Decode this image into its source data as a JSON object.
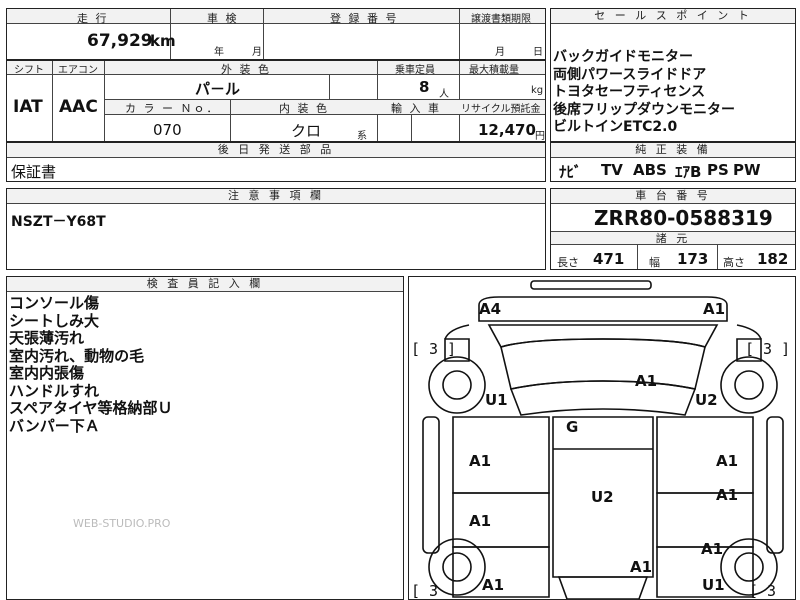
{
  "summary": {
    "mileage_label": "走 行",
    "mileage_value": "67,929",
    "mileage_unit": "km",
    "inspection_label": "車 検",
    "inspection_year": "年",
    "inspection_month": "月",
    "registration_label": "登 録 番 号",
    "transfer_deadline_label": "譲渡書類期限",
    "transfer_month": "月",
    "transfer_day": "日"
  },
  "specs": {
    "shift_label": "シフト",
    "shift_value": "IAT",
    "aircon_label": "エアコン",
    "aircon_value": "AAC",
    "exterior_color_label": "外 装 色",
    "exterior_color_value": "パ－ル",
    "capacity_label": "乗車定員",
    "capacity_value": "8",
    "capacity_unit": "人",
    "max_load_label": "最大積載量",
    "max_load_unit": "kg",
    "color_no_label": "カ ラ ー Ｎｏ．",
    "color_no_value": "070",
    "interior_color_label": "内 装 色",
    "interior_color_value": "クロ",
    "interior_color_suffix": "系",
    "import_label": "輸 入 車",
    "recycle_label": "リサイクル預託金",
    "recycle_value": "12,470",
    "recycle_unit": "円",
    "later_parts_label": "後 日 発 送 部 品",
    "later_parts_value": "保証書"
  },
  "sales_points": {
    "header": "セ ー ル ス ポ イ ン ト",
    "items": [
      "バックガイドモニター",
      "両側パワースライドドア",
      "トヨタセーフティセンス",
      "後席フリップダウンモニター",
      "ビルトインETC2.0"
    ]
  },
  "equipment": {
    "header": "純 正 装 備",
    "items": [
      "ﾅﾋﾞ",
      "TV",
      "ABS",
      "ｴｱB",
      "PS",
      "PW"
    ]
  },
  "notes": {
    "header": "注 意 事 項 欄",
    "value": "NSZT－Y68T"
  },
  "chassis": {
    "header": "車 台 番 号",
    "value": "ZRR80-0588319",
    "dims_header": "諸 元",
    "length_label": "長さ",
    "length_value": "471",
    "width_label": "幅",
    "width_value": "173",
    "height_label": "高さ",
    "height_value": "182"
  },
  "inspector": {
    "header": "検 査 員 記 入 欄",
    "lines": [
      "コンソール傷",
      "シートしみ大",
      "天張薄汚れ",
      "室内汚れ、動物の毛",
      "室内内張傷",
      "ハンドルすれ",
      "スペアタイヤ等格納部Ｕ",
      "バンパー下Ａ"
    ],
    "watermark": "WEB-STUDIO.PRO"
  },
  "diagram": {
    "marks": {
      "a4": "A4",
      "a1_front_right": "A1",
      "b3_left": "[ 3 ]",
      "b3_right": "[ 3 ]",
      "a1_hood": "A1",
      "u1_left_fender": "U1",
      "u2_right_fender": "U2",
      "g_windshield": "G",
      "a1_left_front_door": "A1",
      "a1_right_front_door": "A1",
      "u2_roof": "U2",
      "a1_right_rear_door": "A1",
      "a1_left_rear_door": "A1",
      "a1_right_quarter": "A1",
      "a1_rear_center": "A1",
      "a1_left_rear": "A1",
      "u1_right_rear": "U1",
      "b3_bottom_left": "[ 3",
      "b3_bottom_right": "[ 3"
    }
  }
}
